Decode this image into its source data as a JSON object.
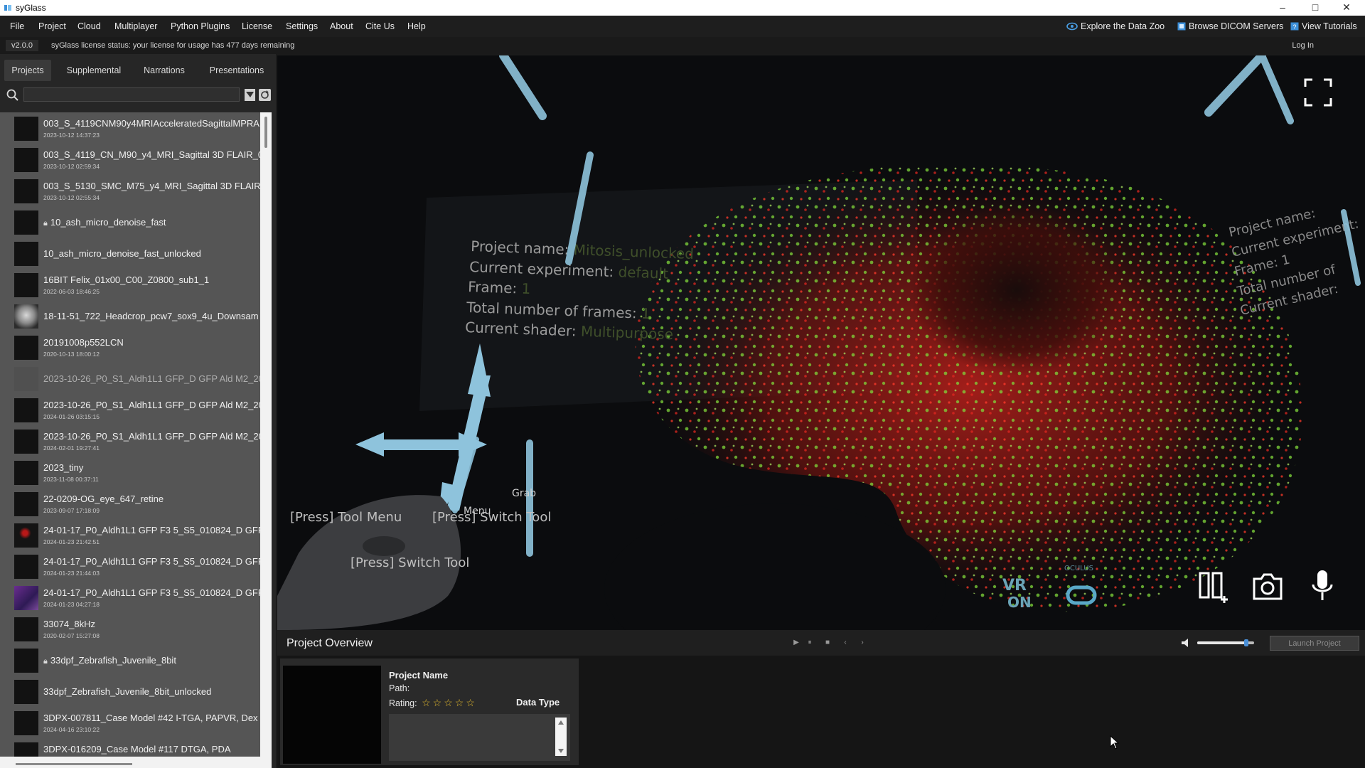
{
  "window": {
    "title": "syGlass",
    "minimize": "–",
    "maximize": "□",
    "close": "✕"
  },
  "menubar": {
    "items": [
      "File",
      "Project",
      "Cloud",
      "Multiplayer",
      "Python Plugins",
      "License",
      "Settings",
      "About",
      "Cite Us",
      "Help"
    ],
    "right": [
      "Explore the Data Zoo",
      "Browse DICOM Servers",
      "View Tutorials"
    ]
  },
  "license_bar": {
    "version": "v2.0.0",
    "status": "syGlass license status: your license for usage has 477 days remaining",
    "login": "Log In"
  },
  "tabs": [
    "Projects",
    "Supplemental",
    "Narrations",
    "Presentations"
  ],
  "search": {
    "value": ""
  },
  "projects": [
    {
      "name": "003_S_4119CNM90y4MRIAcceleratedSagittalMPRA",
      "date": "2023-10-12 14:37:23"
    },
    {
      "name": "003_S_4119_CN_M90_y4_MRI_Sagittal 3D FLAIR_0",
      "date": "2023-10-12 02:59:34"
    },
    {
      "name": "003_S_5130_SMC_M75_y4_MRI_Sagittal 3D FLAIR",
      "date": "2023-10-12 02:55:34"
    },
    {
      "name": "10_ash_micro_denoise_fast",
      "date": "",
      "locked": true
    },
    {
      "name": "10_ash_micro_denoise_fast_unlocked",
      "date": ""
    },
    {
      "name": "16BIT Felix_01x00_C00_Z0800_sub1_1",
      "date": "2022-06-03 18:46:25"
    },
    {
      "name": "18-11-51_722_Headcrop_pcw7_sox9_4u_Downsam",
      "date": ""
    },
    {
      "name": "20191008p552LCN",
      "date": "2020-10-13 18:00:12"
    },
    {
      "name": "2023-10-26_P0_S1_Aldh1L1 GFP_D GFP Ald M2_20",
      "date": "",
      "dim": true
    },
    {
      "name": "2023-10-26_P0_S1_Aldh1L1 GFP_D GFP Ald M2_20",
      "date": "2024-01-26 03:15:15"
    },
    {
      "name": "2023-10-26_P0_S1_Aldh1L1 GFP_D GFP Ald M2_20",
      "date": "2024-02-01 19:27:41"
    },
    {
      "name": "2023_tiny",
      "date": "2023-11-08 00:37:11"
    },
    {
      "name": "22-0209-OG_eye_647_retine",
      "date": "2023-09-07 17:18:09"
    },
    {
      "name": "24-01-17_P0_Aldh1L1 GFP F3 5_S5_010824_D GFP",
      "date": "2024-01-23 21:42:51"
    },
    {
      "name": "24-01-17_P0_Aldh1L1 GFP F3 5_S5_010824_D GFP",
      "date": "2024-01-23 21:44:03"
    },
    {
      "name": "24-01-17_P0_Aldh1L1 GFP F3 5_S5_010824_D GFP",
      "date": "2024-01-23 04:27:18"
    },
    {
      "name": "33074_8kHz",
      "date": "2020-02-07 15:27:08"
    },
    {
      "name": "33dpf_Zebrafish_Juvenile_8bit",
      "date": "",
      "locked": true
    },
    {
      "name": "33dpf_Zebrafish_Juvenile_8bit_unlocked",
      "date": ""
    },
    {
      "name": "3DPX-007811_Case Model #42 I-TGA, PAPVR, Dex",
      "date": "2024-04-16 23:10:22"
    },
    {
      "name": "3DPX-016209_Case Model #117 DTGA, PDA",
      "date": ""
    }
  ],
  "viewport": {
    "overlay_left": [
      "Project name:",
      "Current experiment:",
      "Frame:",
      "Total number of frames:",
      "Current shader:"
    ],
    "overlay_left_values": [
      "Mitosis_unlocked",
      "default",
      "1",
      "1",
      "Multipurpose"
    ],
    "overlay_right": [
      "Project name:",
      "Current experiment:",
      "Frame: 1",
      "Total number of",
      "Current shader:"
    ],
    "controller_labels": [
      "[Press] Tool Menu",
      "[Press] Switch Tool",
      "[Press] Switch Tool",
      "Menu",
      "Grab"
    ],
    "vr_label_top": "VR",
    "vr_label_bottom": "ON",
    "headset_label": "OCULUS"
  },
  "bottom_bar": {
    "title": "Project Overview",
    "launch_label": "Launch Project",
    "volume": 0.9
  },
  "details": {
    "project_name_label": "Project Name",
    "path_label": "Path:",
    "rating_label": "Rating:",
    "rating_value": 0,
    "rating_max": 5,
    "data_type_label": "Data Type"
  },
  "colors": {
    "accent": "#4a90d9",
    "tool_blue": "#8ec3dc",
    "red_channel": "#e0261f",
    "green_channel": "#7fd63a"
  }
}
